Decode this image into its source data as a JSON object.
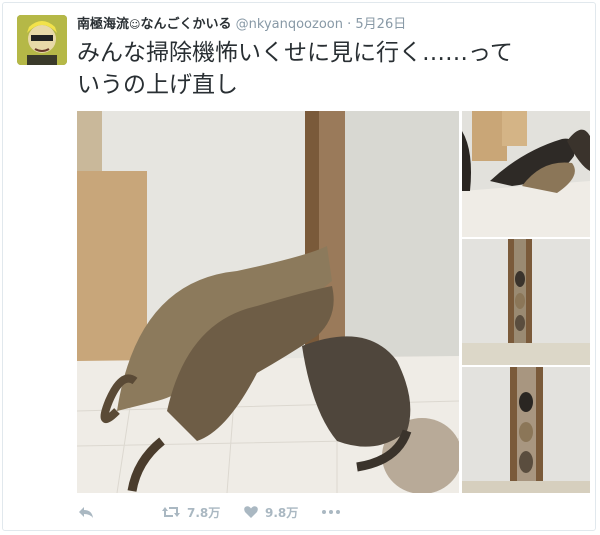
{
  "tweet": {
    "display_name": "南極海流",
    "display_name_suffix": "なんごくかいる",
    "handle": "@nkyanqoozoon",
    "separator": "·",
    "date": "5月26日",
    "text": "みんな掃除機怖いくせに見に行く……って\nいうの上げ直し"
  },
  "actions": {
    "retweet_count": "7.8万",
    "like_count": "9.8万"
  },
  "icons": {
    "reply": "reply-icon",
    "retweet": "retweet-icon",
    "like": "heart-icon",
    "more": "more-dots-icon"
  },
  "colors": {
    "text": "#292f33",
    "muted": "#8899a6",
    "action": "#aab8c2",
    "border": "#e1e8ed"
  }
}
